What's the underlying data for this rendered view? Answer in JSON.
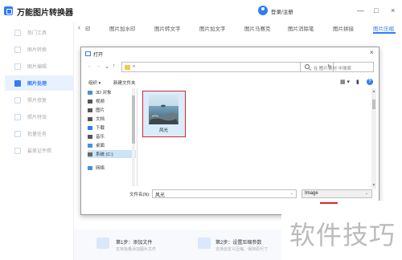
{
  "app": {
    "title": "万能图片转换器",
    "login_label": "登录/注册",
    "window_controls": [
      "—",
      "□",
      "×"
    ]
  },
  "sidebar": {
    "items": [
      {
        "label": "热门工具",
        "active": false
      },
      {
        "label": "图片转换",
        "active": false
      },
      {
        "label": "图片编辑",
        "active": false
      },
      {
        "label": "图片处理",
        "active": true
      },
      {
        "label": "照片修复",
        "active": false
      },
      {
        "label": "照片特效",
        "active": false
      },
      {
        "label": "批量任务",
        "active": false
      },
      {
        "label": "最美证件照",
        "active": false
      }
    ]
  },
  "tabs": {
    "back_arrow": "‹",
    "items": [
      {
        "label": "印",
        "active": false
      },
      {
        "label": "图片加水印",
        "active": false
      },
      {
        "label": "图片转文字",
        "active": false
      },
      {
        "label": "图片加文字",
        "active": false
      },
      {
        "label": "图片马赛克",
        "active": false
      },
      {
        "label": "图片消除笔",
        "active": false
      },
      {
        "label": "图片拼接",
        "active": false
      },
      {
        "label": "图片压缩",
        "active": true
      }
    ]
  },
  "steps": [
    {
      "title": "第1步：添加文件",
      "desc": "支持批量添加图片文件"
    },
    {
      "title": "第2步：设置压缩参数",
      "desc": "支持自定义压缩、保持原尺寸"
    }
  ],
  "dialog": {
    "title": "打开",
    "close": "×",
    "nav": {
      "back": "←",
      "forward": "→",
      "dropdown": "⌄",
      "up": "↑"
    },
    "address": "«",
    "address_dropdown": "⌄",
    "refresh": "↻",
    "search_placeholder": "在 图片素材 中搜索",
    "toolbar": {
      "organize": "组织 ▾",
      "new_folder": "新建文件夹",
      "view_icon": "▦ ▾",
      "pane_icon": "▮",
      "help": "?"
    },
    "nav_pane": [
      {
        "label": "3D 对象",
        "icon": "cube-icon",
        "color": "#4a90d9"
      },
      {
        "label": "视频",
        "icon": "video-icon",
        "color": "#555555"
      },
      {
        "label": "图片",
        "icon": "picture-icon",
        "color": "#555555"
      },
      {
        "label": "文档",
        "icon": "document-icon",
        "color": "#555555"
      },
      {
        "label": "下载",
        "icon": "download-icon",
        "color": "#2f7cf6"
      },
      {
        "label": "音乐",
        "icon": "music-icon",
        "color": "#555555"
      },
      {
        "label": "桌面",
        "icon": "desktop-icon",
        "color": "#4a90d9"
      },
      {
        "label": "系统 (C:)",
        "icon": "drive-icon",
        "color": "#666666",
        "selected": true
      },
      {
        "label": "网络",
        "icon": "network-icon",
        "color": "#4a90d9"
      }
    ],
    "file": {
      "name": "风光"
    },
    "filename_label": "文件名(N):",
    "filename_value": "风光",
    "filetype_value": "Image",
    "dropdown_glyph": "⌄"
  },
  "watermark": "软件技巧"
}
